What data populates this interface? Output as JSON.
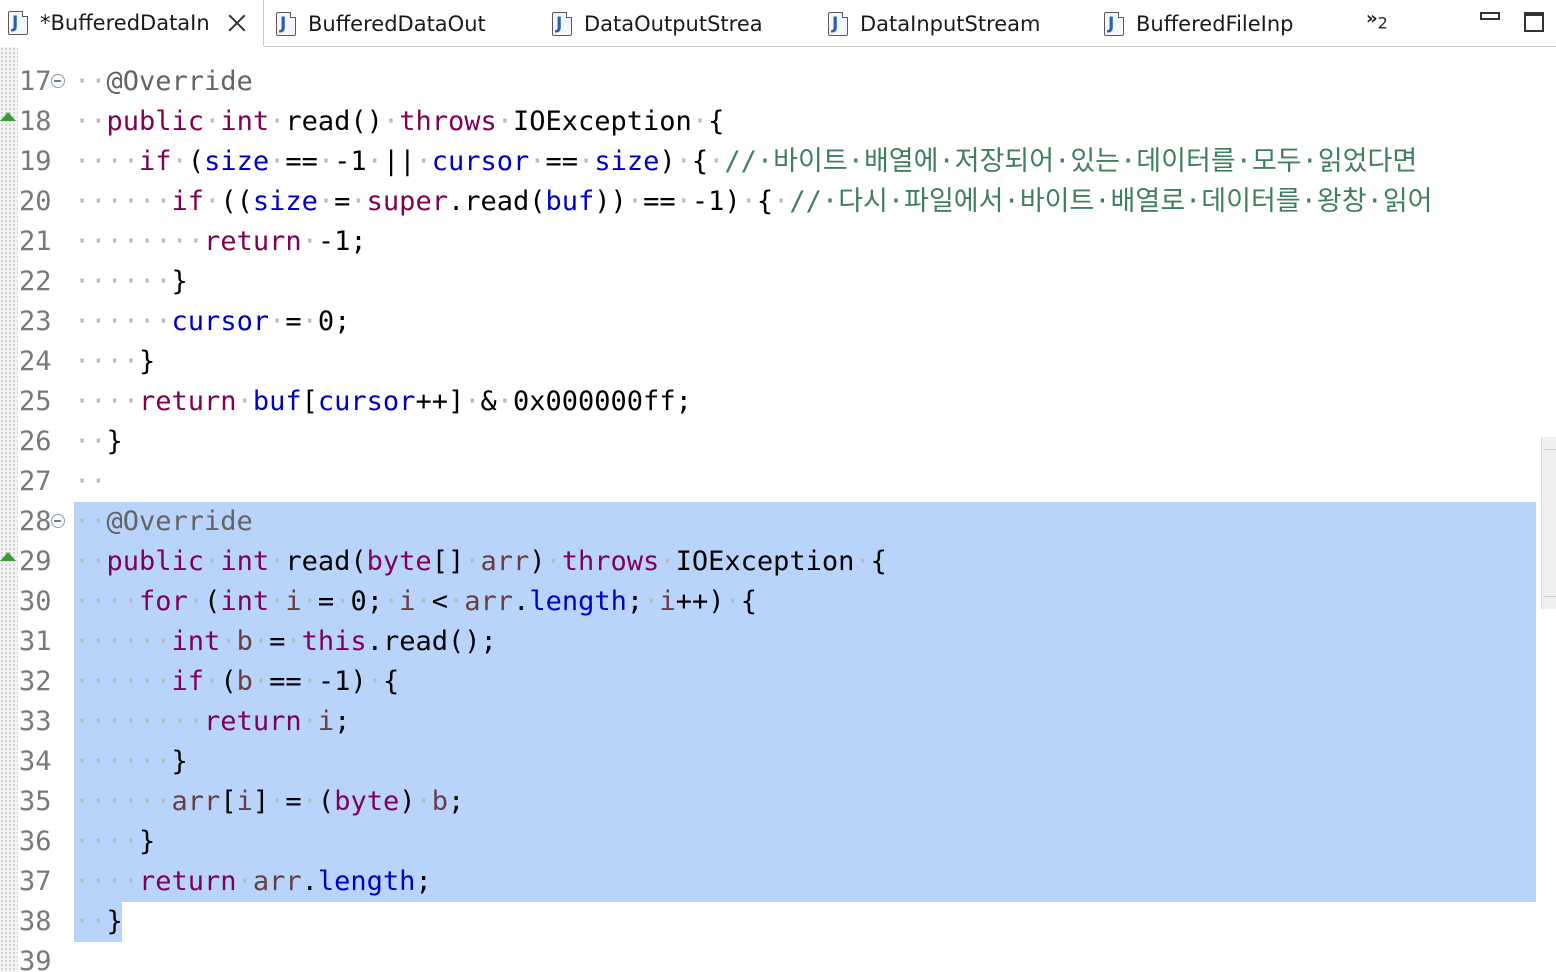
{
  "tabs": [
    {
      "label": "*BufferedDataIn",
      "active": true
    },
    {
      "label": "BufferedDataOut",
      "active": false
    },
    {
      "label": "DataOutputStrea",
      "active": false
    },
    {
      "label": "DataInputStream",
      "active": false
    },
    {
      "label": "BufferedFileInp",
      "active": false
    }
  ],
  "overflow": {
    "chevrons": "»",
    "count": "2"
  },
  "colors": {
    "keyword": "#7f0055",
    "field": "#0000c0",
    "annotation": "#646464",
    "local_var": "#6a3e3e",
    "comment": "#3f7f5f",
    "selection": "#b8d4fb"
  },
  "lines": [
    {
      "num": "17",
      "fold": true,
      "override": false,
      "tokens": [
        [
          "ws",
          "··"
        ],
        [
          "ann",
          "@Override"
        ]
      ]
    },
    {
      "num": "18",
      "fold": false,
      "override": true,
      "tokens": [
        [
          "ws",
          "··"
        ],
        [
          "kw",
          "public"
        ],
        [
          "ws",
          "·"
        ],
        [
          "kw",
          "int"
        ],
        [
          "ws",
          "·"
        ],
        [
          "pl",
          "read()"
        ],
        [
          "ws",
          "·"
        ],
        [
          "kw",
          "throws"
        ],
        [
          "ws",
          "·"
        ],
        [
          "pl",
          "IOException"
        ],
        [
          "ws",
          "·"
        ],
        [
          "pl",
          "{"
        ]
      ]
    },
    {
      "num": "19",
      "fold": false,
      "override": false,
      "tokens": [
        [
          "ws",
          "····"
        ],
        [
          "kw",
          "if"
        ],
        [
          "ws",
          "·"
        ],
        [
          "pl",
          "("
        ],
        [
          "fld",
          "size"
        ],
        [
          "ws",
          "·"
        ],
        [
          "pl",
          "=="
        ],
        [
          "ws",
          "·"
        ],
        [
          "pl",
          "-1"
        ],
        [
          "ws",
          "·"
        ],
        [
          "pl",
          "||"
        ],
        [
          "ws",
          "·"
        ],
        [
          "fld",
          "cursor"
        ],
        [
          "ws",
          "·"
        ],
        [
          "pl",
          "=="
        ],
        [
          "ws",
          "·"
        ],
        [
          "fld",
          "size"
        ],
        [
          "pl",
          ")"
        ],
        [
          "ws",
          "·"
        ],
        [
          "pl",
          "{"
        ],
        [
          "ws",
          "·"
        ],
        [
          "cm",
          "//·바이트·배열에·저장되어·있는·데이터를·모두·읽었다면"
        ]
      ]
    },
    {
      "num": "20",
      "fold": false,
      "override": false,
      "tokens": [
        [
          "ws",
          "······"
        ],
        [
          "kw",
          "if"
        ],
        [
          "ws",
          "·"
        ],
        [
          "pl",
          "(("
        ],
        [
          "fld",
          "size"
        ],
        [
          "ws",
          "·"
        ],
        [
          "pl",
          "="
        ],
        [
          "ws",
          "·"
        ],
        [
          "kw",
          "super"
        ],
        [
          "pl",
          ".read("
        ],
        [
          "fld",
          "buf"
        ],
        [
          "pl",
          "))"
        ],
        [
          "ws",
          "·"
        ],
        [
          "pl",
          "=="
        ],
        [
          "ws",
          "·"
        ],
        [
          "pl",
          "-1)"
        ],
        [
          "ws",
          "·"
        ],
        [
          "pl",
          "{"
        ],
        [
          "ws",
          "·"
        ],
        [
          "cm",
          "//·다시·파일에서·바이트·배열로·데이터를·왕창·읽어"
        ]
      ]
    },
    {
      "num": "21",
      "fold": false,
      "override": false,
      "tokens": [
        [
          "ws",
          "········"
        ],
        [
          "kw",
          "return"
        ],
        [
          "ws",
          "·"
        ],
        [
          "pl",
          "-1;"
        ]
      ]
    },
    {
      "num": "22",
      "fold": false,
      "override": false,
      "tokens": [
        [
          "ws",
          "······"
        ],
        [
          "pl",
          "}"
        ]
      ]
    },
    {
      "num": "23",
      "fold": false,
      "override": false,
      "tokens": [
        [
          "ws",
          "······"
        ],
        [
          "fld",
          "cursor"
        ],
        [
          "ws",
          "·"
        ],
        [
          "pl",
          "="
        ],
        [
          "ws",
          "·"
        ],
        [
          "pl",
          "0;"
        ]
      ]
    },
    {
      "num": "24",
      "fold": false,
      "override": false,
      "tokens": [
        [
          "ws",
          "····"
        ],
        [
          "pl",
          "}"
        ]
      ]
    },
    {
      "num": "25",
      "fold": false,
      "override": false,
      "tokens": [
        [
          "ws",
          "····"
        ],
        [
          "kw",
          "return"
        ],
        [
          "ws",
          "·"
        ],
        [
          "fld",
          "buf"
        ],
        [
          "pl",
          "["
        ],
        [
          "fld",
          "cursor"
        ],
        [
          "pl",
          "++]"
        ],
        [
          "ws",
          "·"
        ],
        [
          "pl",
          "&"
        ],
        [
          "ws",
          "·"
        ],
        [
          "pl",
          "0x000000ff;"
        ]
      ]
    },
    {
      "num": "26",
      "fold": false,
      "override": false,
      "tokens": [
        [
          "ws",
          "··"
        ],
        [
          "pl",
          "}"
        ]
      ]
    },
    {
      "num": "27",
      "fold": false,
      "override": false,
      "tokens": [
        [
          "ws",
          "··"
        ]
      ]
    },
    {
      "num": "28",
      "fold": true,
      "override": false,
      "tokens": [
        [
          "ws",
          "··"
        ],
        [
          "ann",
          "@Override"
        ]
      ]
    },
    {
      "num": "29",
      "fold": false,
      "override": true,
      "tokens": [
        [
          "ws",
          "··"
        ],
        [
          "kw",
          "public"
        ],
        [
          "ws",
          "·"
        ],
        [
          "kw",
          "int"
        ],
        [
          "ws",
          "·"
        ],
        [
          "pl",
          "read("
        ],
        [
          "kw",
          "byte"
        ],
        [
          "pl",
          "[]"
        ],
        [
          "ws",
          "·"
        ],
        [
          "var",
          "arr"
        ],
        [
          "pl",
          ")"
        ],
        [
          "ws",
          "·"
        ],
        [
          "kw",
          "throws"
        ],
        [
          "ws",
          "·"
        ],
        [
          "pl",
          "IOException"
        ],
        [
          "ws",
          "·"
        ],
        [
          "pl",
          "{"
        ]
      ]
    },
    {
      "num": "30",
      "fold": false,
      "override": false,
      "tokens": [
        [
          "ws",
          "····"
        ],
        [
          "kw",
          "for"
        ],
        [
          "ws",
          "·"
        ],
        [
          "pl",
          "("
        ],
        [
          "kw",
          "int"
        ],
        [
          "ws",
          "·"
        ],
        [
          "var",
          "i"
        ],
        [
          "ws",
          "·"
        ],
        [
          "pl",
          "="
        ],
        [
          "ws",
          "·"
        ],
        [
          "pl",
          "0;"
        ],
        [
          "ws",
          "·"
        ],
        [
          "var",
          "i"
        ],
        [
          "ws",
          "·"
        ],
        [
          "pl",
          "<"
        ],
        [
          "ws",
          "·"
        ],
        [
          "var",
          "arr"
        ],
        [
          "pl",
          "."
        ],
        [
          "fld",
          "length"
        ],
        [
          "pl",
          ";"
        ],
        [
          "ws",
          "·"
        ],
        [
          "var",
          "i"
        ],
        [
          "pl",
          "++)"
        ],
        [
          "ws",
          "·"
        ],
        [
          "pl",
          "{"
        ]
      ]
    },
    {
      "num": "31",
      "fold": false,
      "override": false,
      "tokens": [
        [
          "ws",
          "······"
        ],
        [
          "kw",
          "int"
        ],
        [
          "ws",
          "·"
        ],
        [
          "var",
          "b"
        ],
        [
          "ws",
          "·"
        ],
        [
          "pl",
          "="
        ],
        [
          "ws",
          "·"
        ],
        [
          "kw",
          "this"
        ],
        [
          "pl",
          ".read();"
        ]
      ]
    },
    {
      "num": "32",
      "fold": false,
      "override": false,
      "tokens": [
        [
          "ws",
          "······"
        ],
        [
          "kw",
          "if"
        ],
        [
          "ws",
          "·"
        ],
        [
          "pl",
          "("
        ],
        [
          "var",
          "b"
        ],
        [
          "ws",
          "·"
        ],
        [
          "pl",
          "=="
        ],
        [
          "ws",
          "·"
        ],
        [
          "pl",
          "-1)"
        ],
        [
          "ws",
          "·"
        ],
        [
          "pl",
          "{"
        ]
      ]
    },
    {
      "num": "33",
      "fold": false,
      "override": false,
      "tokens": [
        [
          "ws",
          "········"
        ],
        [
          "kw",
          "return"
        ],
        [
          "ws",
          "·"
        ],
        [
          "var",
          "i"
        ],
        [
          "pl",
          ";"
        ]
      ]
    },
    {
      "num": "34",
      "fold": false,
      "override": false,
      "tokens": [
        [
          "ws",
          "······"
        ],
        [
          "pl",
          "}"
        ]
      ]
    },
    {
      "num": "35",
      "fold": false,
      "override": false,
      "tokens": [
        [
          "ws",
          "······"
        ],
        [
          "var",
          "arr"
        ],
        [
          "pl",
          "["
        ],
        [
          "var",
          "i"
        ],
        [
          "pl",
          "]"
        ],
        [
          "ws",
          "·"
        ],
        [
          "pl",
          "="
        ],
        [
          "ws",
          "·"
        ],
        [
          "pl",
          "("
        ],
        [
          "kw",
          "byte"
        ],
        [
          "pl",
          ")"
        ],
        [
          "ws",
          "·"
        ],
        [
          "var",
          "b"
        ],
        [
          "pl",
          ";"
        ]
      ]
    },
    {
      "num": "36",
      "fold": false,
      "override": false,
      "tokens": [
        [
          "ws",
          "····"
        ],
        [
          "pl",
          "}"
        ]
      ]
    },
    {
      "num": "37",
      "fold": false,
      "override": false,
      "tokens": [
        [
          "ws",
          "····"
        ],
        [
          "kw",
          "return"
        ],
        [
          "ws",
          "·"
        ],
        [
          "var",
          "arr"
        ],
        [
          "pl",
          "."
        ],
        [
          "fld",
          "length"
        ],
        [
          "pl",
          ";"
        ]
      ]
    },
    {
      "num": "38",
      "fold": false,
      "override": false,
      "tokens": [
        [
          "ws",
          "··"
        ],
        [
          "pl",
          "}"
        ]
      ]
    },
    {
      "num": "39",
      "fold": false,
      "override": false,
      "tokens": []
    }
  ]
}
